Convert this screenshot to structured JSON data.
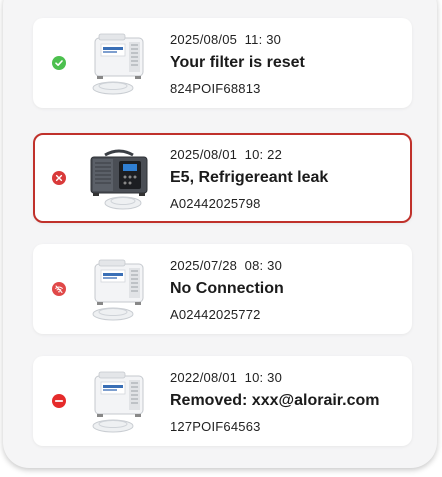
{
  "notifications": [
    {
      "date": "2025/08/05  11: 30",
      "title": "Your filter is reset",
      "serial": "824POIF68813",
      "status": "success",
      "status_icon": "check-circle-icon",
      "status_color": "#4cc04e",
      "device_icon": "white-dehumidifier-icon",
      "selected": false
    },
    {
      "date": "2025/08/01  10: 22",
      "title": "E5, Refrigereant leak",
      "serial": "A02442025798",
      "status": "error",
      "status_icon": "x-circle-icon",
      "status_color": "#d93a3a",
      "device_icon": "dark-dehumidifier-icon",
      "selected": true
    },
    {
      "date": "2025/07/28  08: 30",
      "title": "No Connection",
      "serial": "A02442025772",
      "status": "offline",
      "status_icon": "no-connection-icon",
      "status_color": "#e04848",
      "device_icon": "white-dehumidifier-icon",
      "selected": false
    },
    {
      "date": "2022/08/01  10: 30",
      "title": "Removed: xxx@alorair.com",
      "serial": "127POIF64563",
      "status": "removed",
      "status_icon": "minus-circle-icon",
      "status_color": "#e52b2b",
      "device_icon": "white-dehumidifier-icon",
      "selected": false
    }
  ],
  "colors": {
    "selected_border": "#c0312b",
    "panel_background": "#f5f5f6",
    "card_background": "#ffffff"
  }
}
